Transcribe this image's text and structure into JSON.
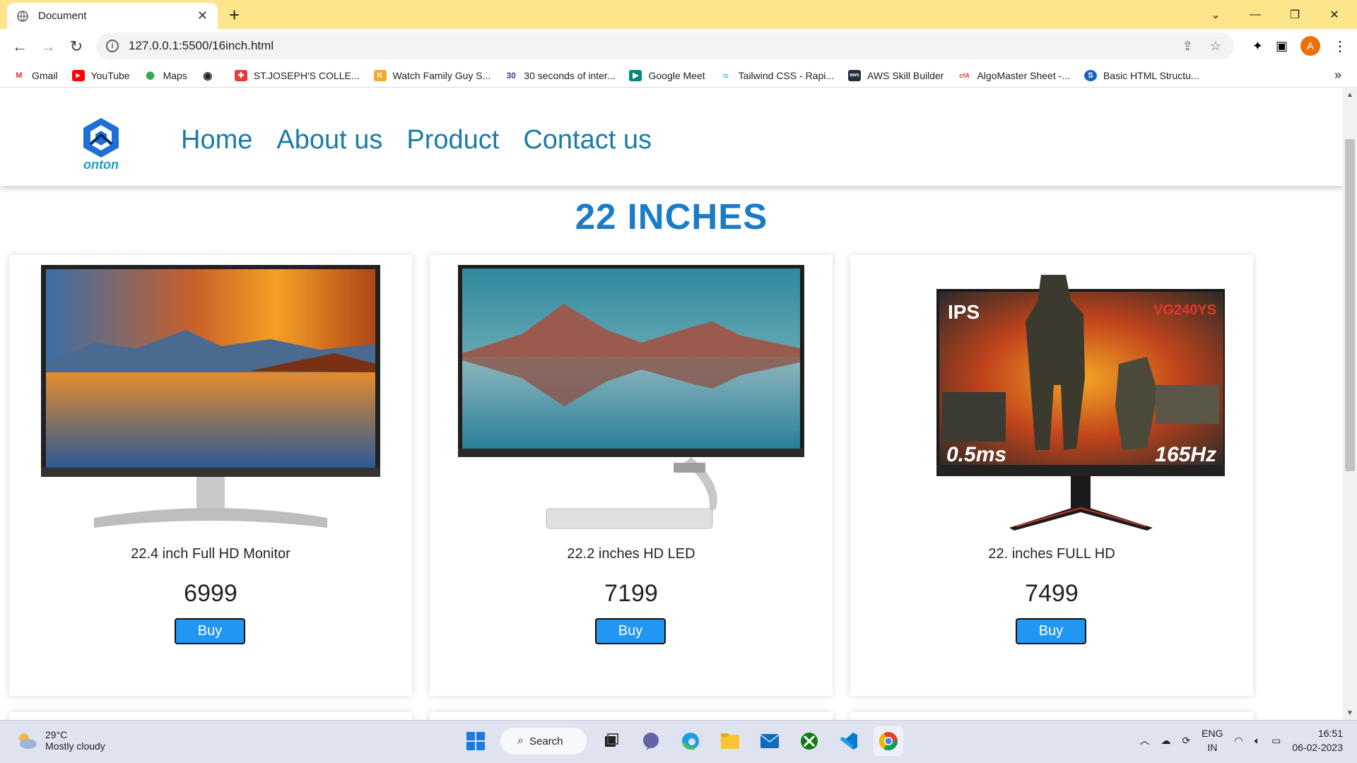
{
  "browser": {
    "tab_title": "Document",
    "url": "127.0.0.1:5500/16inch.html",
    "avatar_letter": "A",
    "bookmarks": [
      {
        "label": "Gmail",
        "icon": "gmail-icon"
      },
      {
        "label": "YouTube",
        "icon": "youtube-icon"
      },
      {
        "label": "Maps",
        "icon": "maps-icon"
      },
      {
        "label": "",
        "icon": "globe-icon"
      },
      {
        "label": "ST.JOSEPH'S COLLE...",
        "icon": "college-icon"
      },
      {
        "label": "Watch Family Guy S...",
        "icon": "k-icon"
      },
      {
        "label": "30 seconds of inter...",
        "icon": "thirty-icon",
        "icon_text": "30"
      },
      {
        "label": "Google Meet",
        "icon": "meet-icon"
      },
      {
        "label": "Tailwind CSS - Rapi...",
        "icon": "tailwind-icon"
      },
      {
        "label": "AWS Skill Builder",
        "icon": "aws-icon"
      },
      {
        "label": "AlgoMaster Sheet -...",
        "icon": "algomaster-icon"
      },
      {
        "label": "Basic HTML Structu...",
        "icon": "html-icon"
      }
    ]
  },
  "site": {
    "logo_text": "onton",
    "nav": [
      "Home",
      "About us",
      "Product",
      "Contact us"
    ],
    "heading": "22 INCHES",
    "products": [
      {
        "name": "22.4 inch Full HD Monitor",
        "price": "6999",
        "button": "Buy"
      },
      {
        "name": "22.2 inches HD LED",
        "price": "7199",
        "button": "Buy"
      },
      {
        "name": "22. inches FULL HD",
        "price": "7499",
        "button": "Buy",
        "screen_text_left": "IPS",
        "screen_text_right": "VG240YS",
        "screen_badge_left": "0.5ms",
        "screen_badge_right": "165Hz"
      }
    ]
  },
  "taskbar": {
    "weather_temp": "29°C",
    "weather_desc": "Mostly cloudy",
    "search_label": "Search",
    "lang_top": "ENG",
    "lang_bottom": "IN",
    "time": "16:51",
    "date": "06-02-2023"
  },
  "colors": {
    "chrome_title": "#fde58c",
    "nav_link": "#1a7ca8",
    "heading": "#1a7cc7",
    "buy_button": "#2196f3"
  }
}
